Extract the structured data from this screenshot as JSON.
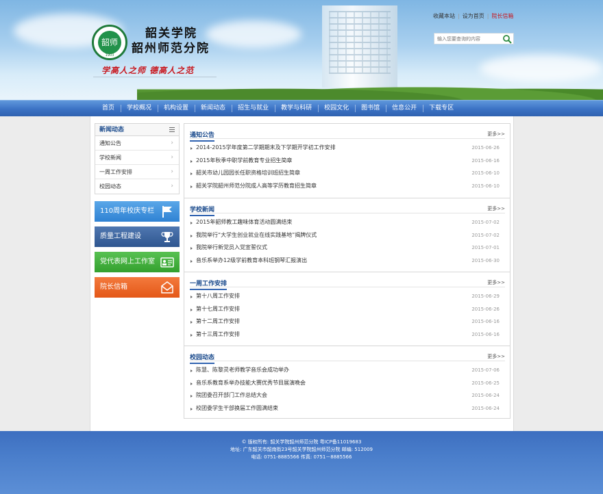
{
  "header": {
    "logo_top_text": "SHAOGUAN HUIYI",
    "logo_center": "韶师",
    "logo_year": "1903",
    "school_name_line1": "韶关学院",
    "school_name_line2": "韶州师范分院",
    "motto": "学高人之师  德高人之范",
    "toplinks": [
      "收藏本站",
      "设为首页",
      "院长信箱"
    ],
    "search_placeholder": "输入您要查询的内容"
  },
  "nav": {
    "items": [
      "首页",
      "学校概况",
      "机构设置",
      "新闻动态",
      "招生与就业",
      "教学与科研",
      "校园文化",
      "图书馆",
      "信息公开",
      "下载专区"
    ]
  },
  "sidebar": {
    "title": "新闻动态",
    "items": [
      "通知公告",
      "学校新闻",
      "一周工作安排",
      "校园动态"
    ],
    "promos": [
      "110周年校庆专栏",
      "质量工程建设",
      "党代表网上工作室",
      "院长信箱"
    ]
  },
  "sections": [
    {
      "title": "通知公告",
      "more": "更多>>",
      "rows": [
        {
          "title": "2014-2015学年度第二学期期末及下学期开学初工作安排",
          "date": "2015-06-26"
        },
        {
          "title": "2015年秋季中职学前教育专业招生简章",
          "date": "2015-06-16"
        },
        {
          "title": "韶关市幼儿园园长任职资格培训班招生简章",
          "date": "2015-06-10"
        },
        {
          "title": "韶关学院韶州师范分院成人高等学历教育招生简章",
          "date": "2015-06-10"
        }
      ]
    },
    {
      "title": "学校新闻",
      "more": "更多>>",
      "rows": [
        {
          "title": "2015年韶师教工趣味体育活动圆满结束",
          "date": "2015-07-02"
        },
        {
          "title": "我院举行“大学生创业就业在线实践基地”揭牌仪式",
          "date": "2015-07-02"
        },
        {
          "title": "我院举行新党员入党宣誓仪式",
          "date": "2015-07-01"
        },
        {
          "title": "音乐系举办12级学前教育本科班钢琴汇报演出",
          "date": "2015-06-30"
        }
      ]
    },
    {
      "title": "一周工作安排",
      "more": "更多>>",
      "rows": [
        {
          "title": "第十八周工作安排",
          "date": "2015-06-29"
        },
        {
          "title": "第十七周工作安排",
          "date": "2015-06-26"
        },
        {
          "title": "第十二周工作安排",
          "date": "2015-06-16"
        },
        {
          "title": "第十三周工作安排",
          "date": "2015-06-16"
        }
      ]
    },
    {
      "title": "校园动态",
      "more": "更多>>",
      "rows": [
        {
          "title": "陈慧、陈黎灵老师教学音乐会成功举办",
          "date": "2015-07-06"
        },
        {
          "title": "音乐系教育系举办技能大赛优秀节目展演晚会",
          "date": "2015-06-25"
        },
        {
          "title": "院团委召开部门工作总结大会",
          "date": "2015-06-24"
        },
        {
          "title": "校团委学生干部换届工作圆满结束",
          "date": "2015-06-24"
        }
      ]
    }
  ],
  "footer": {
    "line1": "© 版权所有: 韶关学院韶州师范分院  粤ICP备11019683",
    "line2": "地址: 广东韶关市韶南街23号韶关学院韶州师范分院  邮编: 512009",
    "line3": "电话: 0751-8885566  传真: 0751－8885566"
  }
}
